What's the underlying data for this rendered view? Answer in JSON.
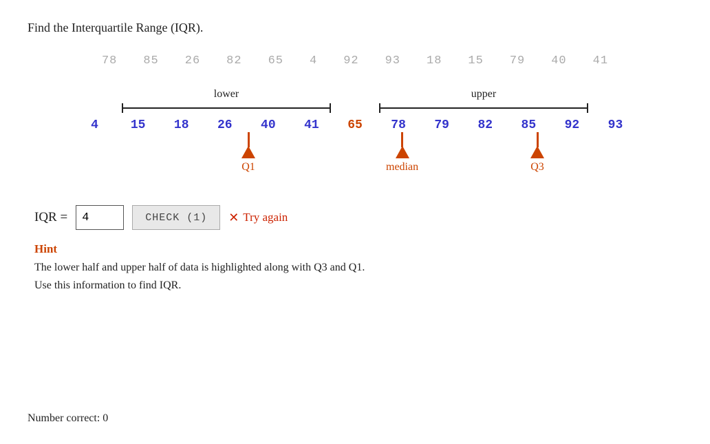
{
  "page": {
    "title": "Find the Interquartile Range (IQR).",
    "unsorted_numbers": [
      "78",
      "85",
      "26",
      "82",
      "65",
      "4",
      "92",
      "93",
      "18",
      "15",
      "79",
      "40",
      "41"
    ],
    "sorted_numbers": [
      {
        "val": "4",
        "color": "blue"
      },
      {
        "val": "15",
        "color": "blue"
      },
      {
        "val": "18",
        "color": "blue"
      },
      {
        "val": "26",
        "color": "blue"
      },
      {
        "val": "40",
        "color": "blue"
      },
      {
        "val": "41",
        "color": "blue"
      },
      {
        "val": "65",
        "color": "orange"
      },
      {
        "val": "78",
        "color": "blue"
      },
      {
        "val": "79",
        "color": "blue"
      },
      {
        "val": "82",
        "color": "blue"
      },
      {
        "val": "85",
        "color": "blue"
      },
      {
        "val": "92",
        "color": "blue"
      },
      {
        "val": "93",
        "color": "blue"
      }
    ],
    "lower_label": "lower",
    "upper_label": "upper",
    "q1_label": "Q1",
    "q1_value": "26",
    "median_label": "median",
    "median_value": "65",
    "q3_label": "Q3",
    "q3_value": "85",
    "iqr_label": "IQR =",
    "input_value": "4",
    "check_button": "CHECK (1)",
    "try_again_text": "Try again",
    "hint_title": "Hint",
    "hint_line1": "The lower half and upper half of data is highlighted along with Q3 and Q1.",
    "hint_line2": "Use this information to find IQR.",
    "number_correct_label": "Number correct: 0",
    "colors": {
      "blue": "#3333cc",
      "orange": "#cc4400",
      "red": "#cc2200",
      "gray": "#aaa"
    }
  }
}
